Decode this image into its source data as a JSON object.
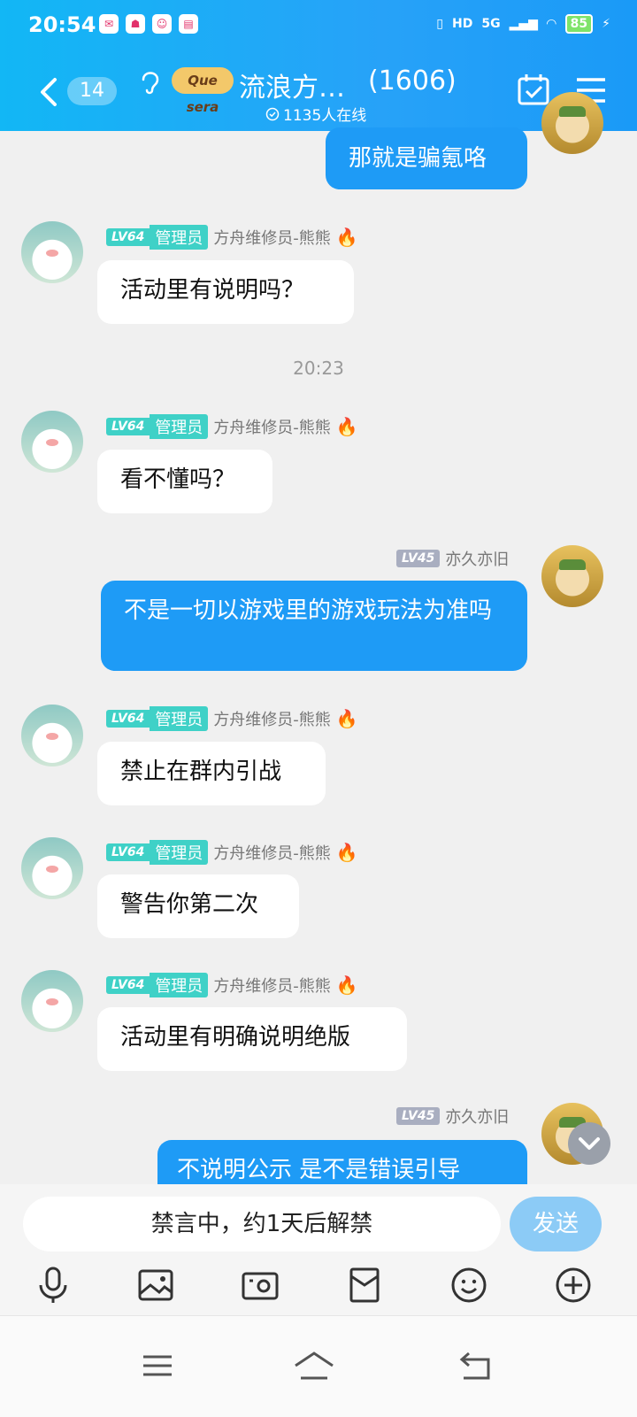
{
  "status_bar": {
    "time": "20:54",
    "network": "5G",
    "hd": "HD",
    "battery": "85"
  },
  "header": {
    "unread_count": "14",
    "group_logo_text": "Que sera",
    "group_name": "流浪方…",
    "member_count": "(1606)",
    "online_text": "1135人在线"
  },
  "messages": [
    {
      "side": "out",
      "text": "那就是骗氪咯"
    },
    {
      "side": "in",
      "level": "LV64",
      "role": "管理员",
      "sender": "方舟维修员-熊熊",
      "text": "活动里有说明吗？"
    },
    {
      "side": "in",
      "level": "LV64",
      "role": "管理员",
      "sender": "方舟维修员-熊熊",
      "text": "看不懂吗？"
    },
    {
      "side": "out",
      "level": "LV45",
      "sender": "亦久亦旧",
      "text": "不是一切以游戏里的游戏玩法为准吗"
    },
    {
      "side": "in",
      "level": "LV64",
      "role": "管理员",
      "sender": "方舟维修员-熊熊",
      "text": "禁止在群内引战"
    },
    {
      "side": "in",
      "level": "LV64",
      "role": "管理员",
      "sender": "方舟维修员-熊熊",
      "text": "警告你第二次"
    },
    {
      "side": "in",
      "level": "LV64",
      "role": "管理员",
      "sender": "方舟维修员-熊熊",
      "text": "活动里有明确说明绝版"
    },
    {
      "side": "out",
      "level": "LV45",
      "sender": "亦久亦旧",
      "text": "不说明公示 是不是错误引导"
    }
  ],
  "timestamp": "20:23",
  "composer": {
    "muted_text": "禁言中，约1天后解禁",
    "send_label": "发送"
  },
  "toolbar_icons": [
    "microphone-icon",
    "image-icon",
    "camera-icon",
    "red-packet-icon",
    "emoji-icon",
    "plus-icon"
  ],
  "colors": {
    "header_gradient_start": "#12b7f5",
    "header_gradient_end": "#1a9af7",
    "outgoing_bubble": "#1e9bf6",
    "admin_badge": "#3fd1c7",
    "send_button": "#8ccbf6"
  }
}
